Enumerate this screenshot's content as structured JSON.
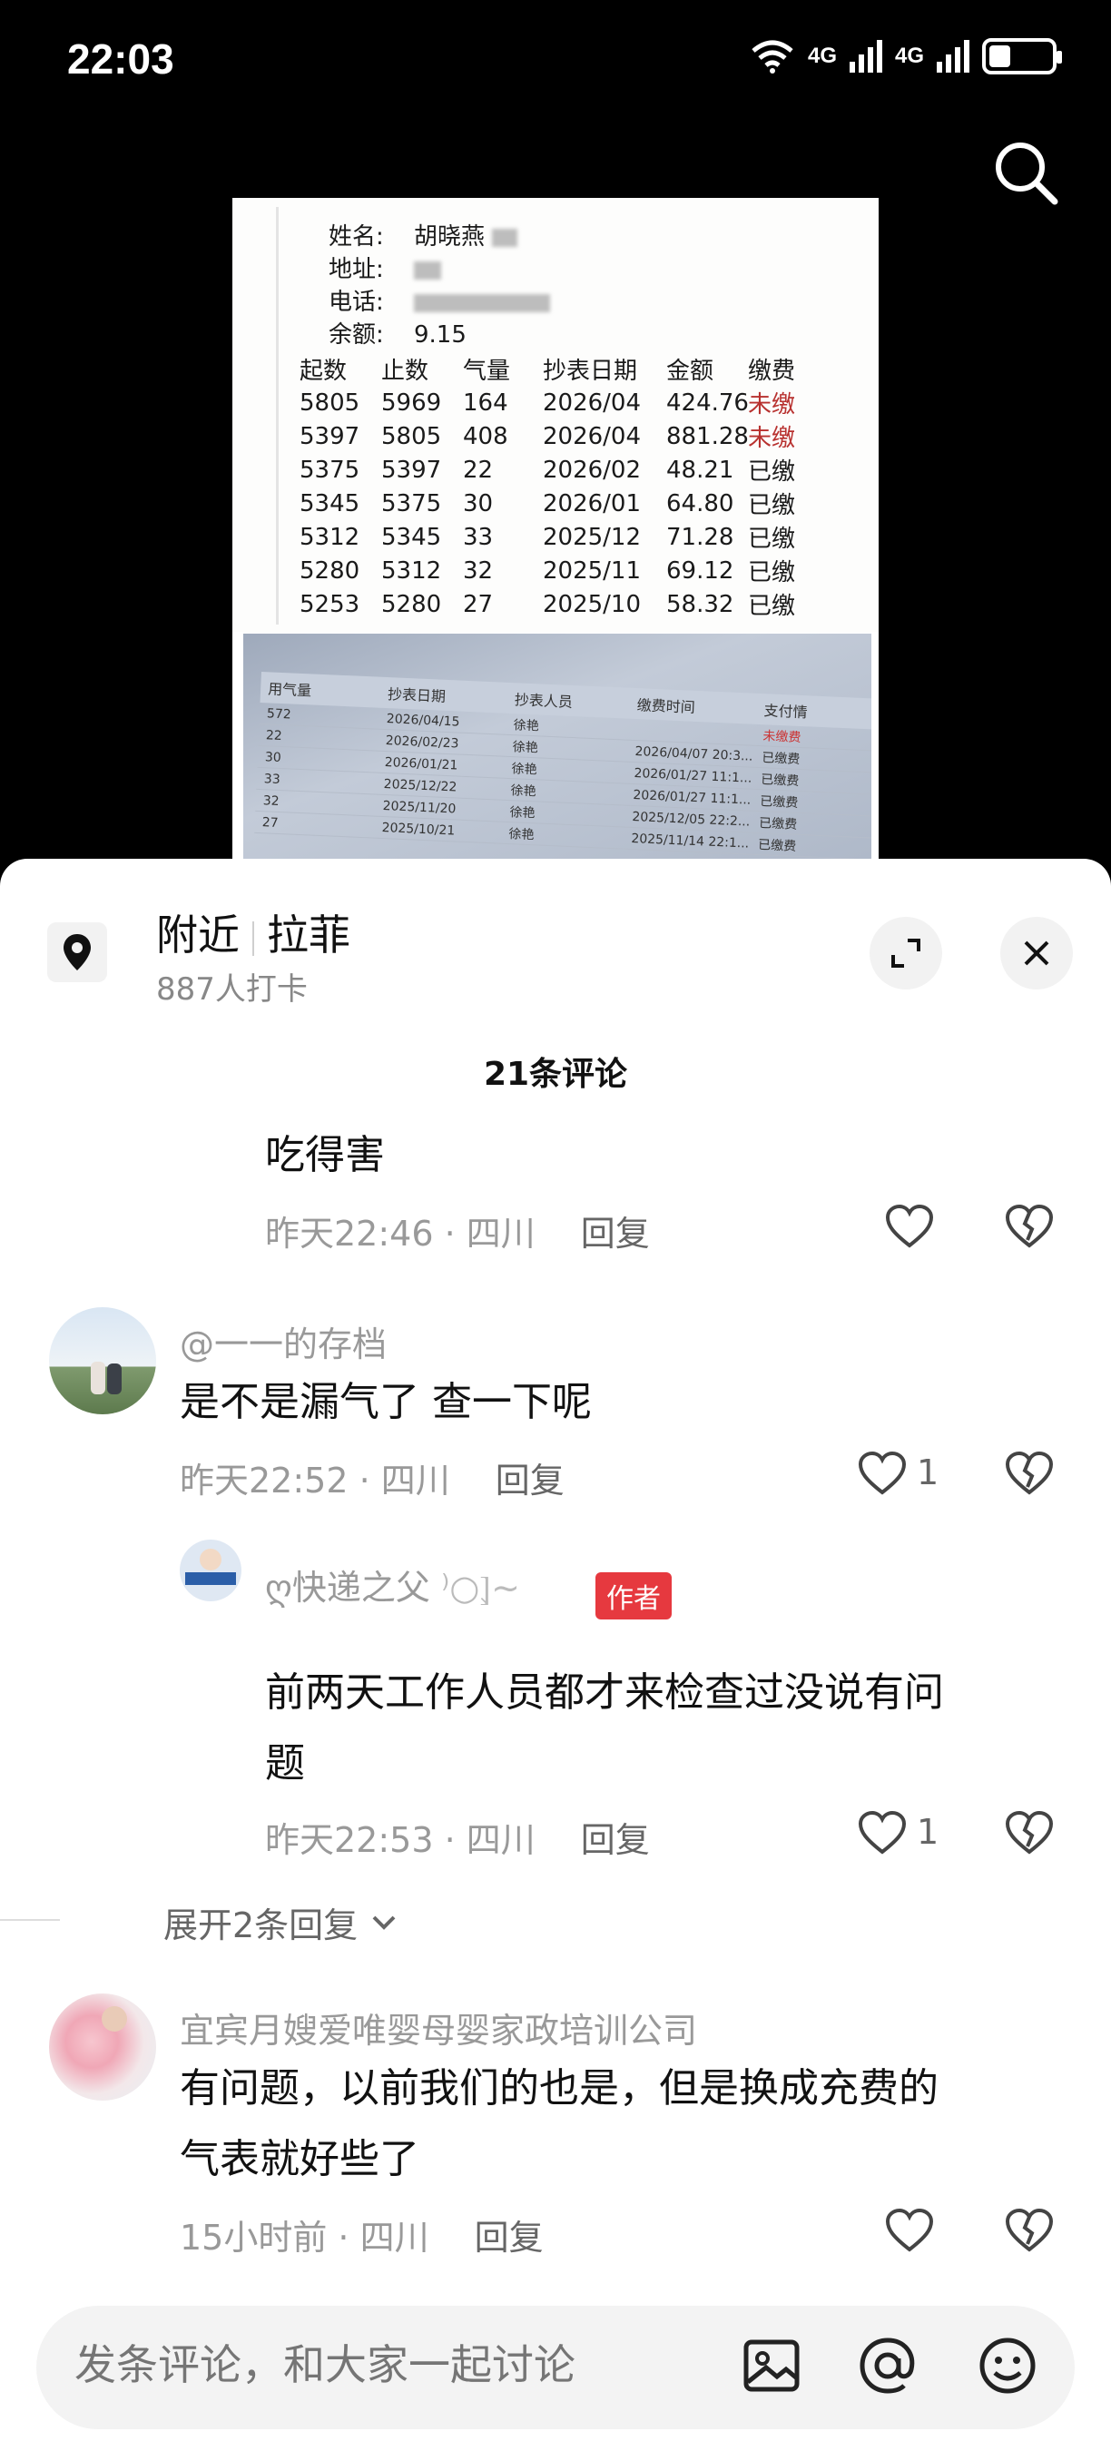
{
  "status_bar": {
    "time": "22:03",
    "net1": "4G",
    "net2": "4G",
    "battery_level": 0.35
  },
  "photo": {
    "info": [
      {
        "label": "姓名:",
        "value": "胡晓燕"
      },
      {
        "label": "地址:",
        "value": ""
      },
      {
        "label": "电话:",
        "value": ""
      },
      {
        "label": "余额:",
        "value": "9.15"
      }
    ],
    "table_headers": [
      "起数",
      "止数",
      "气量",
      "抄表日期",
      "金额",
      "缴费"
    ],
    "table_rows": [
      [
        "5805",
        "5969",
        "164",
        "2026/04",
        "424.76",
        "未缴"
      ],
      [
        "5397",
        "5805",
        "408",
        "2026/04",
        "881.28",
        "未缴"
      ],
      [
        "5375",
        "5397",
        "22",
        "2026/02",
        "48.21",
        "已缴"
      ],
      [
        "5345",
        "5375",
        "30",
        "2026/01",
        "64.80",
        "已缴"
      ],
      [
        "5312",
        "5345",
        "33",
        "2025/12",
        "71.28",
        "已缴"
      ],
      [
        "5280",
        "5312",
        "32",
        "2025/11",
        "69.12",
        "已缴"
      ],
      [
        "5253",
        "5280",
        "27",
        "2025/10",
        "58.32",
        "已缴"
      ]
    ],
    "screen_headers": [
      "用气量",
      "抄表日期",
      "抄表人员",
      "缴费时间",
      "支付情"
    ],
    "screen_rows": [
      [
        "572",
        "2026/04/15",
        "徐艳",
        "",
        "未缴费"
      ],
      [
        "22",
        "2026/02/23",
        "徐艳",
        "2026/04/07 20:3...",
        "已缴费"
      ],
      [
        "30",
        "2026/01/21",
        "徐艳",
        "2026/01/27 11:1...",
        "已缴费"
      ],
      [
        "33",
        "2025/12/22",
        "徐艳",
        "2026/01/27 11:1...",
        "已缴费"
      ],
      [
        "32",
        "2025/11/20",
        "徐艳",
        "2025/12/05 22:2...",
        "已缴费"
      ],
      [
        "27",
        "2025/10/21",
        "徐艳",
        "2025/11/14 22:1...",
        "已缴费"
      ]
    ]
  },
  "location": {
    "title": "附近",
    "name": "拉菲",
    "checkins": "887人打卡"
  },
  "comments_header": {
    "count_label": "21条评论"
  },
  "comments": [
    {
      "text": "吃得害",
      "time": "昨天22:46 · 四川",
      "reply": "回复",
      "likes": ""
    },
    {
      "user": "@一一的存档",
      "text": "是不是漏气了 查一下呢",
      "time": "昨天22:52 · 四川",
      "reply": "回复",
      "likes": "1"
    },
    {
      "user": "ღ快递之父",
      "author_tag": "作者",
      "text_line1": "前两天工作人员都才来检查过没说有问",
      "text_line2": "题",
      "time": "昨天22:53 · 四川",
      "reply": "回复",
      "likes": "1"
    },
    {
      "user": "宜宾月嫂爱唯婴母婴家政培训公司",
      "text_line1": "有问题，以前我们的也是，但是换成充费的",
      "text_line2": "气表就好些了",
      "time": "15小时前 · 四川",
      "reply": "回复",
      "likes": ""
    }
  ],
  "expand_replies": "展开2条回复",
  "input": {
    "placeholder": "发条评论，和大家一起讨论"
  },
  "colors": {
    "author_tag": "#e6393f",
    "unpaid": "#b8312f",
    "sheet": "#ffffff"
  }
}
